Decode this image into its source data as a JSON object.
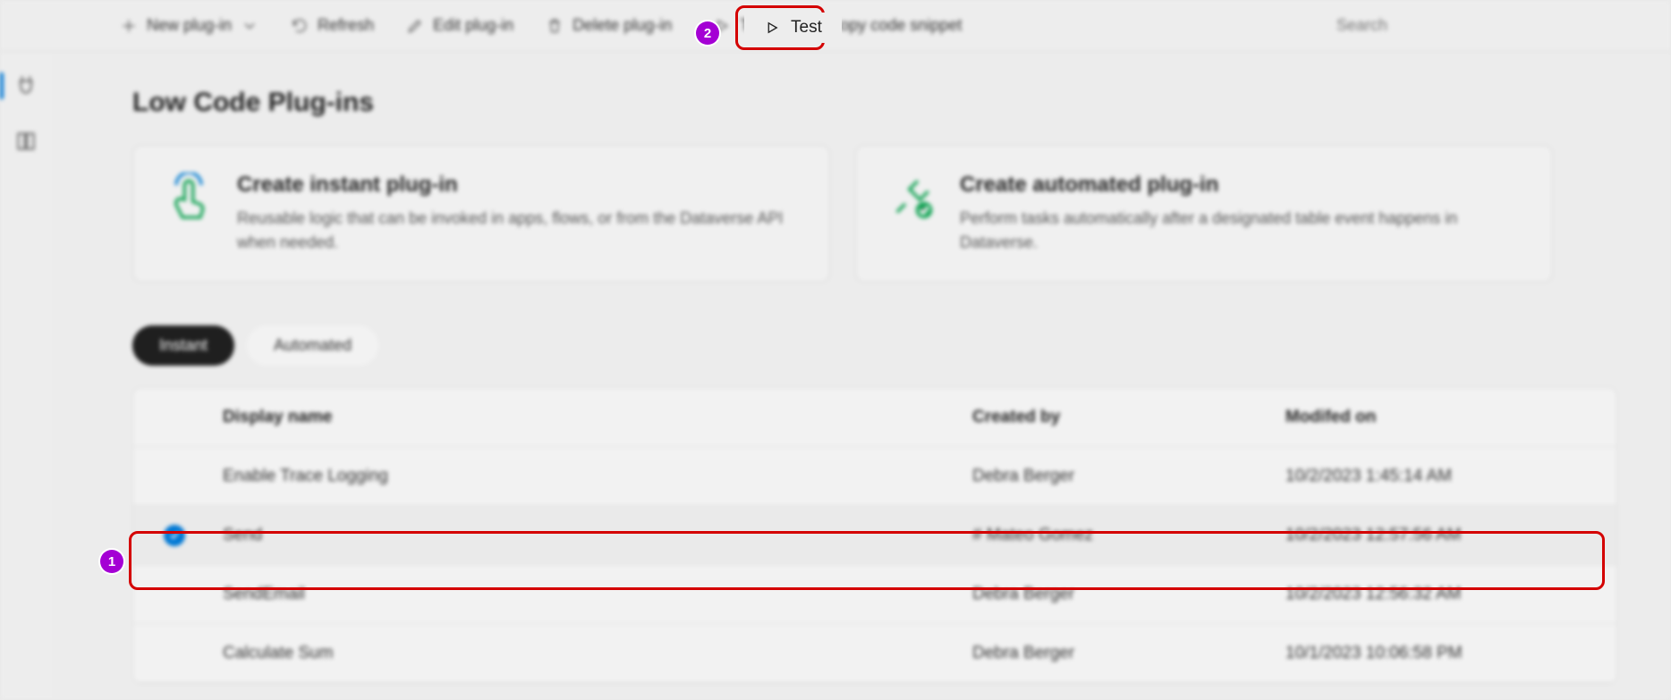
{
  "toolbar": {
    "new_plugin": "New plug-in",
    "refresh": "Refresh",
    "edit": "Edit plug-in",
    "delete": "Delete plug-in",
    "test": "Test",
    "copy": "Copy code snippet",
    "search_placeholder": "Search"
  },
  "page": {
    "title": "Low Code Plug-ins"
  },
  "cards": {
    "instant": {
      "title": "Create instant plug-in",
      "desc": "Reusable logic that can be invoked in apps, flows, or from the Dataverse API when needed."
    },
    "automated": {
      "title": "Create automated plug-in",
      "desc": "Perform tasks automatically after a designated table event happens in Dataverse."
    }
  },
  "tabs": {
    "instant": "Instant",
    "automated": "Automated"
  },
  "table": {
    "headers": {
      "name": "Display name",
      "createdby": "Created by",
      "modified": "Modifed on"
    },
    "rows": [
      {
        "name": "Enable Trace Logging",
        "createdby": "Debra Berger",
        "modified": "10/2/2023 1:45:14 AM",
        "selected": false
      },
      {
        "name": "Send",
        "createdby": "# Mateo Gomez",
        "modified": "10/2/2023 12:57:56 AM",
        "selected": true
      },
      {
        "name": "SendEmail",
        "createdby": "Debra Berger",
        "modified": "10/2/2023 12:56:32 AM",
        "selected": false
      },
      {
        "name": "Calculate Sum",
        "createdby": "Debra Berger",
        "modified": "10/1/2023 10:06:58 PM",
        "selected": false
      }
    ]
  },
  "callouts": {
    "one": "1",
    "two": "2"
  }
}
